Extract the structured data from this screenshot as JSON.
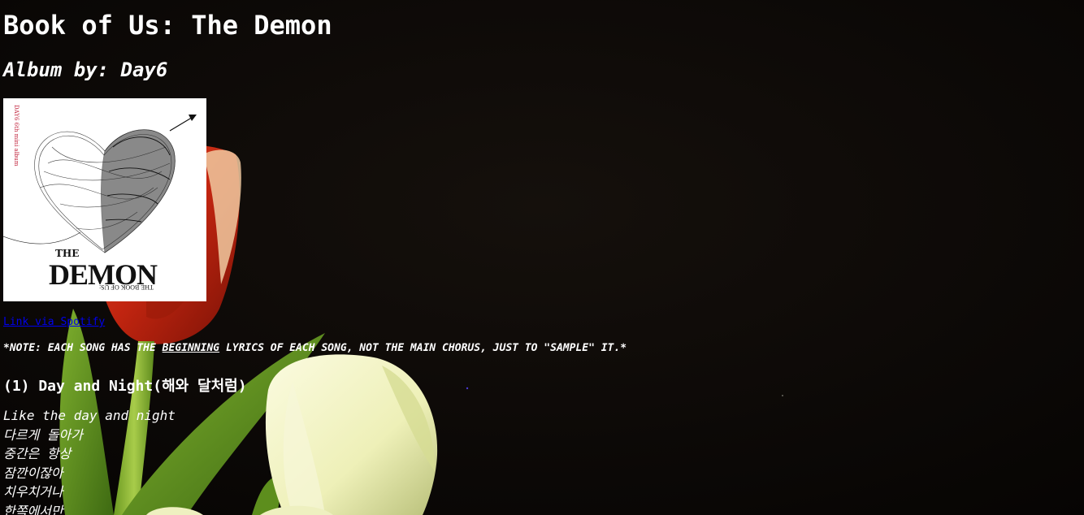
{
  "page": {
    "title": "Book of Us: The Demon",
    "subtitle": "Album by: Day6"
  },
  "album_cover": {
    "side_text": "DAY6 6th mini album",
    "the_text": "THE",
    "demon_text": "DEMON",
    "book_text": "THE BOOK OF US:"
  },
  "spotify_link": {
    "label": "Link via Spotify"
  },
  "note": {
    "prefix": "*NOTE: EACH SONG HAS THE ",
    "emphasis": "BEGINNING",
    "suffix": " LYRICS OF EACH SONG, NOT THE MAIN CHORUS, JUST TO \"SAMPLE\" IT.*"
  },
  "songs": [
    {
      "heading": "(1) Day and Night(해와 달처럼)",
      "lyrics": [
        "Like the day and night",
        "다르게 돌아가",
        "중간은 항상",
        "잠깐이잖아",
        "치우치거나",
        "한쪽에서만"
      ]
    }
  ],
  "colors": {
    "background": "#0a0706",
    "text": "#ffffff",
    "link": "#0000ee"
  }
}
